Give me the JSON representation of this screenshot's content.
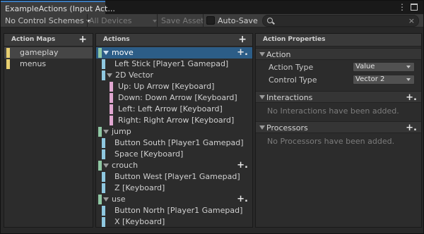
{
  "window": {
    "tab_title": "ExampleActions (Input Act..."
  },
  "toolbar": {
    "control_schemes": "No Control Schemes",
    "devices": "All Devices",
    "save_asset": "Save Asset",
    "auto_save": "Auto-Save",
    "search_placeholder": "",
    "search_clear": "×"
  },
  "action_maps": {
    "title": "Action Maps",
    "add": "+",
    "items": [
      {
        "label": "gameplay",
        "selected": true
      },
      {
        "label": "menus",
        "selected": false
      }
    ]
  },
  "actions": {
    "title": "Actions",
    "add": "+",
    "rows": [
      {
        "kind": "action",
        "label": "move",
        "selected": true,
        "plus": "+."
      },
      {
        "kind": "binding",
        "label": "Left Stick [Player1 Gamepad]"
      },
      {
        "kind": "composite",
        "label": "2D Vector"
      },
      {
        "kind": "part",
        "label": "Up: Up Arrow [Keyboard]"
      },
      {
        "kind": "part",
        "label": "Down: Down Arrow [Keyboard]"
      },
      {
        "kind": "part",
        "label": "Left: Left Arrow [Keyboard]"
      },
      {
        "kind": "part",
        "label": "Right: Right Arrow [Keyboard]"
      },
      {
        "kind": "action",
        "label": "jump",
        "plus": "+."
      },
      {
        "kind": "binding",
        "label": "Button South [Player1 Gamepad]"
      },
      {
        "kind": "binding",
        "label": "Space [Keyboard]"
      },
      {
        "kind": "action",
        "label": "crouch",
        "plus": "+."
      },
      {
        "kind": "binding",
        "label": "Button West [Player1 Gamepad]"
      },
      {
        "kind": "binding",
        "label": "Z [Keyboard]"
      },
      {
        "kind": "action",
        "label": "use",
        "plus": "+."
      },
      {
        "kind": "binding",
        "label": "Button North [Player1 Gamepad]"
      },
      {
        "kind": "binding",
        "label": "X [Keyboard]"
      }
    ]
  },
  "properties": {
    "title": "Action Properties",
    "action_section": "Action",
    "action_type_label": "Action Type",
    "action_type_value": "Value",
    "control_type_label": "Control Type",
    "control_type_value": "Vector 2",
    "interactions_section": "Interactions",
    "interactions_add": "+.",
    "interactions_empty": "No Interactions have been added.",
    "processors_section": "Processors",
    "processors_add": "+.",
    "processors_empty": "No Processors have been added."
  },
  "colors": {
    "selection": "#2c5d87",
    "action_map_bar": "#e8cf70",
    "action_bar": "#8fc7a3",
    "binding_bar": "#8fc8e0",
    "composite_bar": "#e0a7d0"
  }
}
